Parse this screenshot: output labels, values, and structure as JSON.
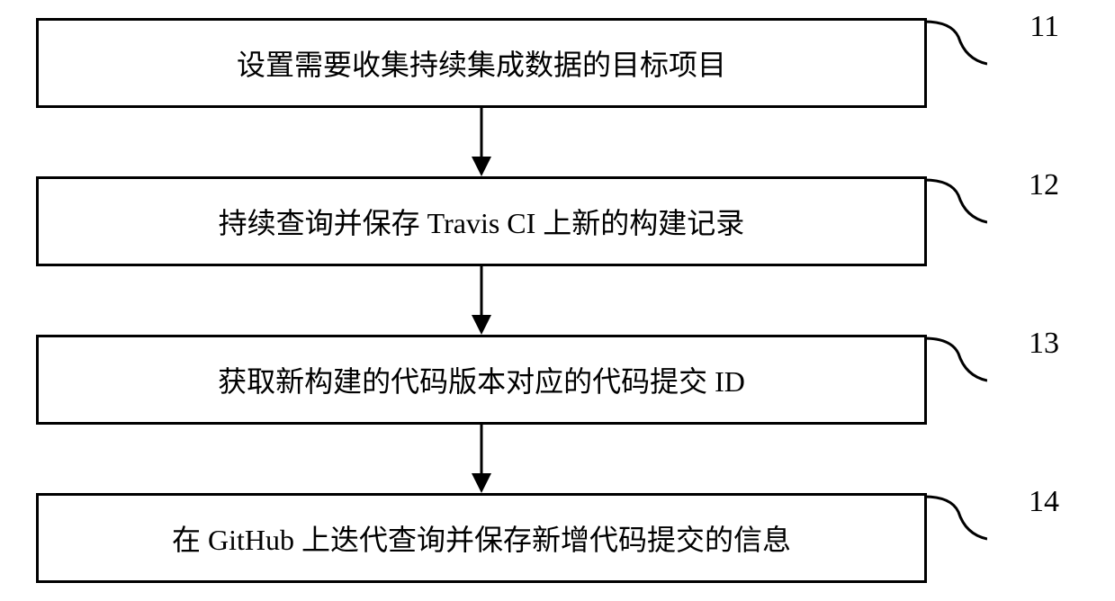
{
  "diagram": {
    "type": "flowchart",
    "direction": "vertical",
    "steps": [
      {
        "n": "11",
        "text": "设置需要收集持续集成数据的目标项目"
      },
      {
        "n": "12",
        "text": "持续查询并保存 Travis CI 上新的构建记录"
      },
      {
        "n": "13",
        "text": "获取新构建的代码版本对应的代码提交 ID"
      },
      {
        "n": "14",
        "text": "在 GitHub 上迭代查询并保存新增代码提交的信息"
      }
    ]
  }
}
